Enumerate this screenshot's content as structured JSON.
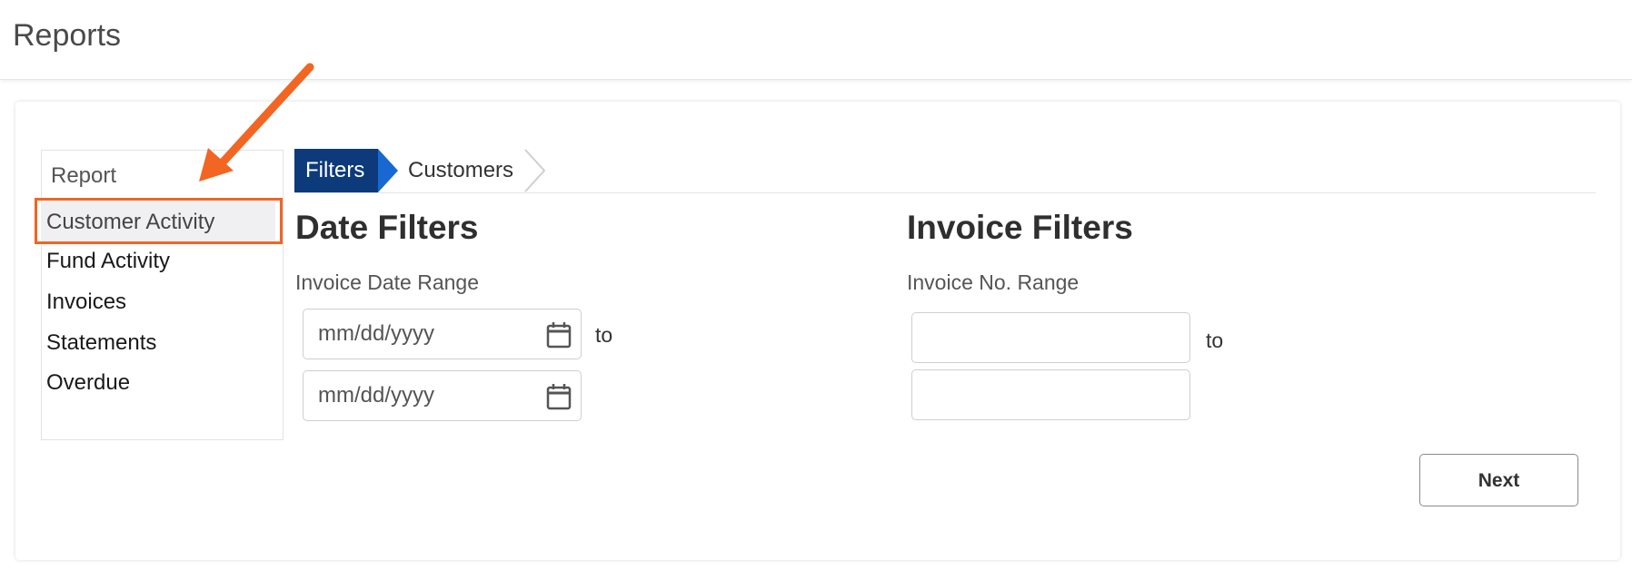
{
  "header": {
    "title": "Reports"
  },
  "sidebar": {
    "heading": "Report",
    "items": [
      {
        "label": "Customer Activity",
        "active": true
      },
      {
        "label": "Fund Activity"
      },
      {
        "label": "Invoices"
      },
      {
        "label": "Statements"
      },
      {
        "label": "Overdue"
      }
    ]
  },
  "breadcrumb": {
    "steps": [
      {
        "label": "Filters",
        "active": true
      },
      {
        "label": "Customers"
      }
    ]
  },
  "date_filters": {
    "title": "Date Filters",
    "range_label": "Invoice Date Range",
    "from_value": "mm/dd/yyyy",
    "to_value": "mm/dd/yyyy",
    "to_text": "to"
  },
  "invoice_filters": {
    "title": "Invoice Filters",
    "range_label": "Invoice No. Range",
    "from_value": "",
    "to_value": "",
    "to_text": "to"
  },
  "actions": {
    "next_label": "Next"
  },
  "colors": {
    "highlight": "#f26522",
    "breadcrumb_active": "#0c3a7a",
    "breadcrumb_arrow": "#1768d3"
  },
  "icons": [
    "calendar-icon",
    "annotation-arrow",
    "chevron-right-icon"
  ]
}
